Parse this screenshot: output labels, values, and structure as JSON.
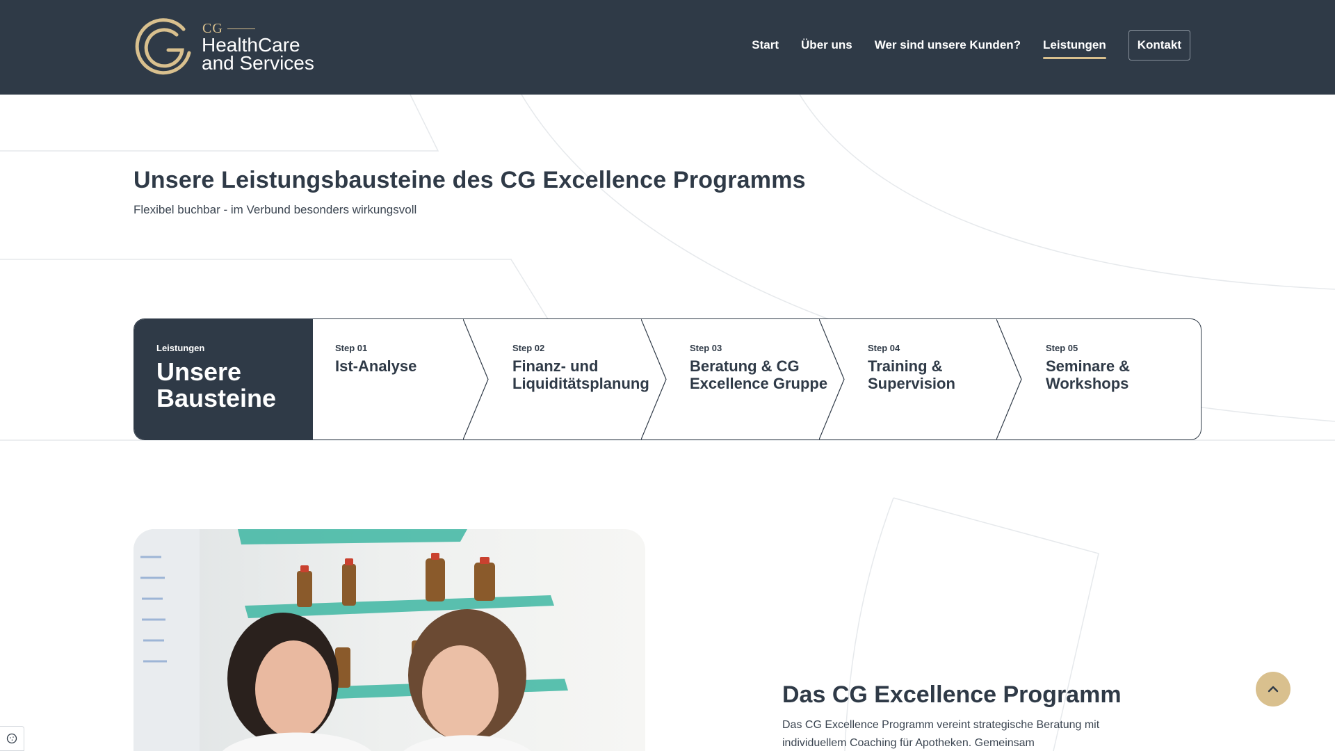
{
  "brand": {
    "logo_small": "CG",
    "logo_text": "HealthCare and Services",
    "accent_color": "#d9c08e",
    "header_color": "#2f3a47"
  },
  "nav": {
    "items": [
      {
        "label": "Start"
      },
      {
        "label": "Über uns"
      },
      {
        "label": "Wer sind unsere Kunden?"
      },
      {
        "label": "Leistungen",
        "active": true
      }
    ],
    "cta_label": "Kontakt"
  },
  "intro": {
    "title": "Unsere Leistungsbausteine des CG Excellence Programms",
    "subtitle": "Flexibel buchbar - im Verbund besonders wirkungsvoll"
  },
  "steps": {
    "eyebrow": "Leistungen",
    "title": "Unsere Bausteine",
    "items": [
      {
        "number": "Step 01",
        "title": "Ist-Analyse"
      },
      {
        "number": "Step 02",
        "title": "Finanz- und Liquiditätsplanung"
      },
      {
        "number": "Step 03",
        "title": "Beratung & CG Excellence Gruppe"
      },
      {
        "number": "Step 04",
        "title": "Training & Supervision"
      },
      {
        "number": "Step 05",
        "title": "Seminare & Workshops"
      }
    ]
  },
  "program": {
    "title": "Das CG Excellence Programm",
    "text": "Das CG Excellence Programm vereint strategische Beratung mit individuellem Coaching für Apotheken. Gemeinsam"
  },
  "icons": {
    "scroll_top": "chevron-up-icon",
    "cookie": "info-icon"
  }
}
